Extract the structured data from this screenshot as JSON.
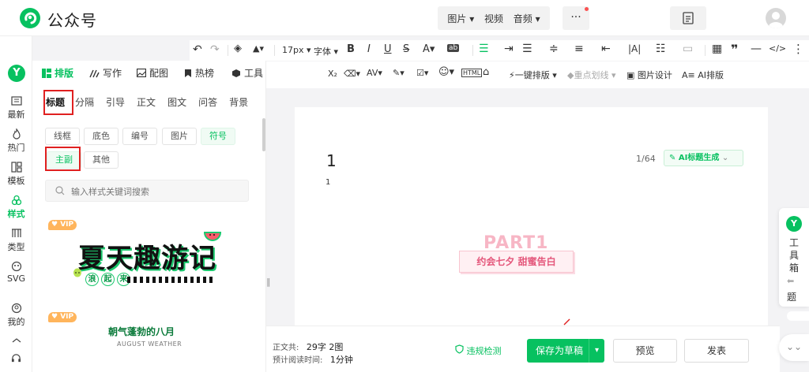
{
  "header": {
    "brand": "公众号",
    "media": [
      "图片",
      "视频",
      "音频"
    ],
    "more": "···"
  },
  "leftnav": [
    {
      "label": "最新",
      "icon": "news-icon"
    },
    {
      "label": "热门",
      "icon": "fire-icon"
    },
    {
      "label": "模板",
      "icon": "template-icon"
    },
    {
      "label": "样式",
      "icon": "style-icon"
    },
    {
      "label": "类型",
      "icon": "type-icon"
    },
    {
      "label": "SVG",
      "icon": "svg-icon"
    },
    {
      "label": "我的",
      "icon": "user-icon"
    }
  ],
  "panel_tabs": [
    {
      "label": "排版",
      "icon": "layout-icon"
    },
    {
      "label": "写作",
      "icon": "pen-icon"
    },
    {
      "label": "配图",
      "icon": "image-icon"
    },
    {
      "label": "热榜",
      "icon": "bookmark-icon"
    },
    {
      "label": "工具",
      "icon": "cube-icon"
    }
  ],
  "categories": [
    "标题",
    "分隔",
    "引导",
    "正文",
    "图文",
    "问答",
    "背景"
  ],
  "chips": [
    "线框",
    "底色",
    "编号",
    "图片",
    "符号",
    "主副",
    "其他"
  ],
  "search": {
    "placeholder": "输入样式关键词搜索"
  },
  "vip_label": "VIP",
  "sample1": {
    "title": "夏天趣游记",
    "chars": [
      "浪",
      "起",
      "来"
    ]
  },
  "sample2": {
    "title": "朝气蓬勃的八月",
    "subtitle": "AUGUST WEATHER"
  },
  "toolbar": {
    "font_size": "17px",
    "font": "字体",
    "one_click": "一键排版",
    "highlight": "重点划线",
    "image_design": "图片设计",
    "ai_layout": "AI排版"
  },
  "editor": {
    "title": "1",
    "subtitle": "1",
    "count": "1/64",
    "ai_title_btn": "AI标题生成",
    "part": "PART1",
    "part_caption": "约会七夕 甜蜜告白"
  },
  "bottom": {
    "word_label": "正文共:",
    "words": "29字 2图",
    "read_label": "预计阅读时间:",
    "read_time": "1分钟",
    "check": "违规检测",
    "save": "保存为草稿",
    "preview": "预览",
    "publish": "发表"
  },
  "tool_box": {
    "label": "工具箱",
    "label2": "题"
  },
  "colors": {
    "brand_green": "#07c160",
    "outline_red": "#e02020",
    "pink": "#e4557a"
  }
}
